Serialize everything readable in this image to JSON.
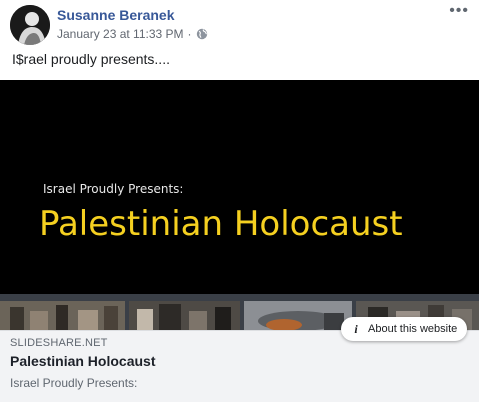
{
  "post": {
    "author": "Susanne Beranek",
    "timestamp": "January 23 at 11:33 PM",
    "separator": "·",
    "audience_icon": "globe-icon",
    "more_icon": "more-options-icon",
    "more_glyph": "•••",
    "text": "I$rael proudly presents...."
  },
  "link_preview": {
    "image_subtitle": "Israel Proudly Presents:",
    "image_title": "Palestinian Holocaust",
    "about_icon_glyph": "i",
    "about_label": "About this website",
    "domain": "SLIDESHARE.NET",
    "title": "Palestinian Holocaust",
    "description": "Israel Proudly Presents:"
  },
  "colors": {
    "author_link": "#385898",
    "preview_background": "#000000",
    "preview_title": "#f5d020",
    "caption_background": "#f2f3f5"
  }
}
